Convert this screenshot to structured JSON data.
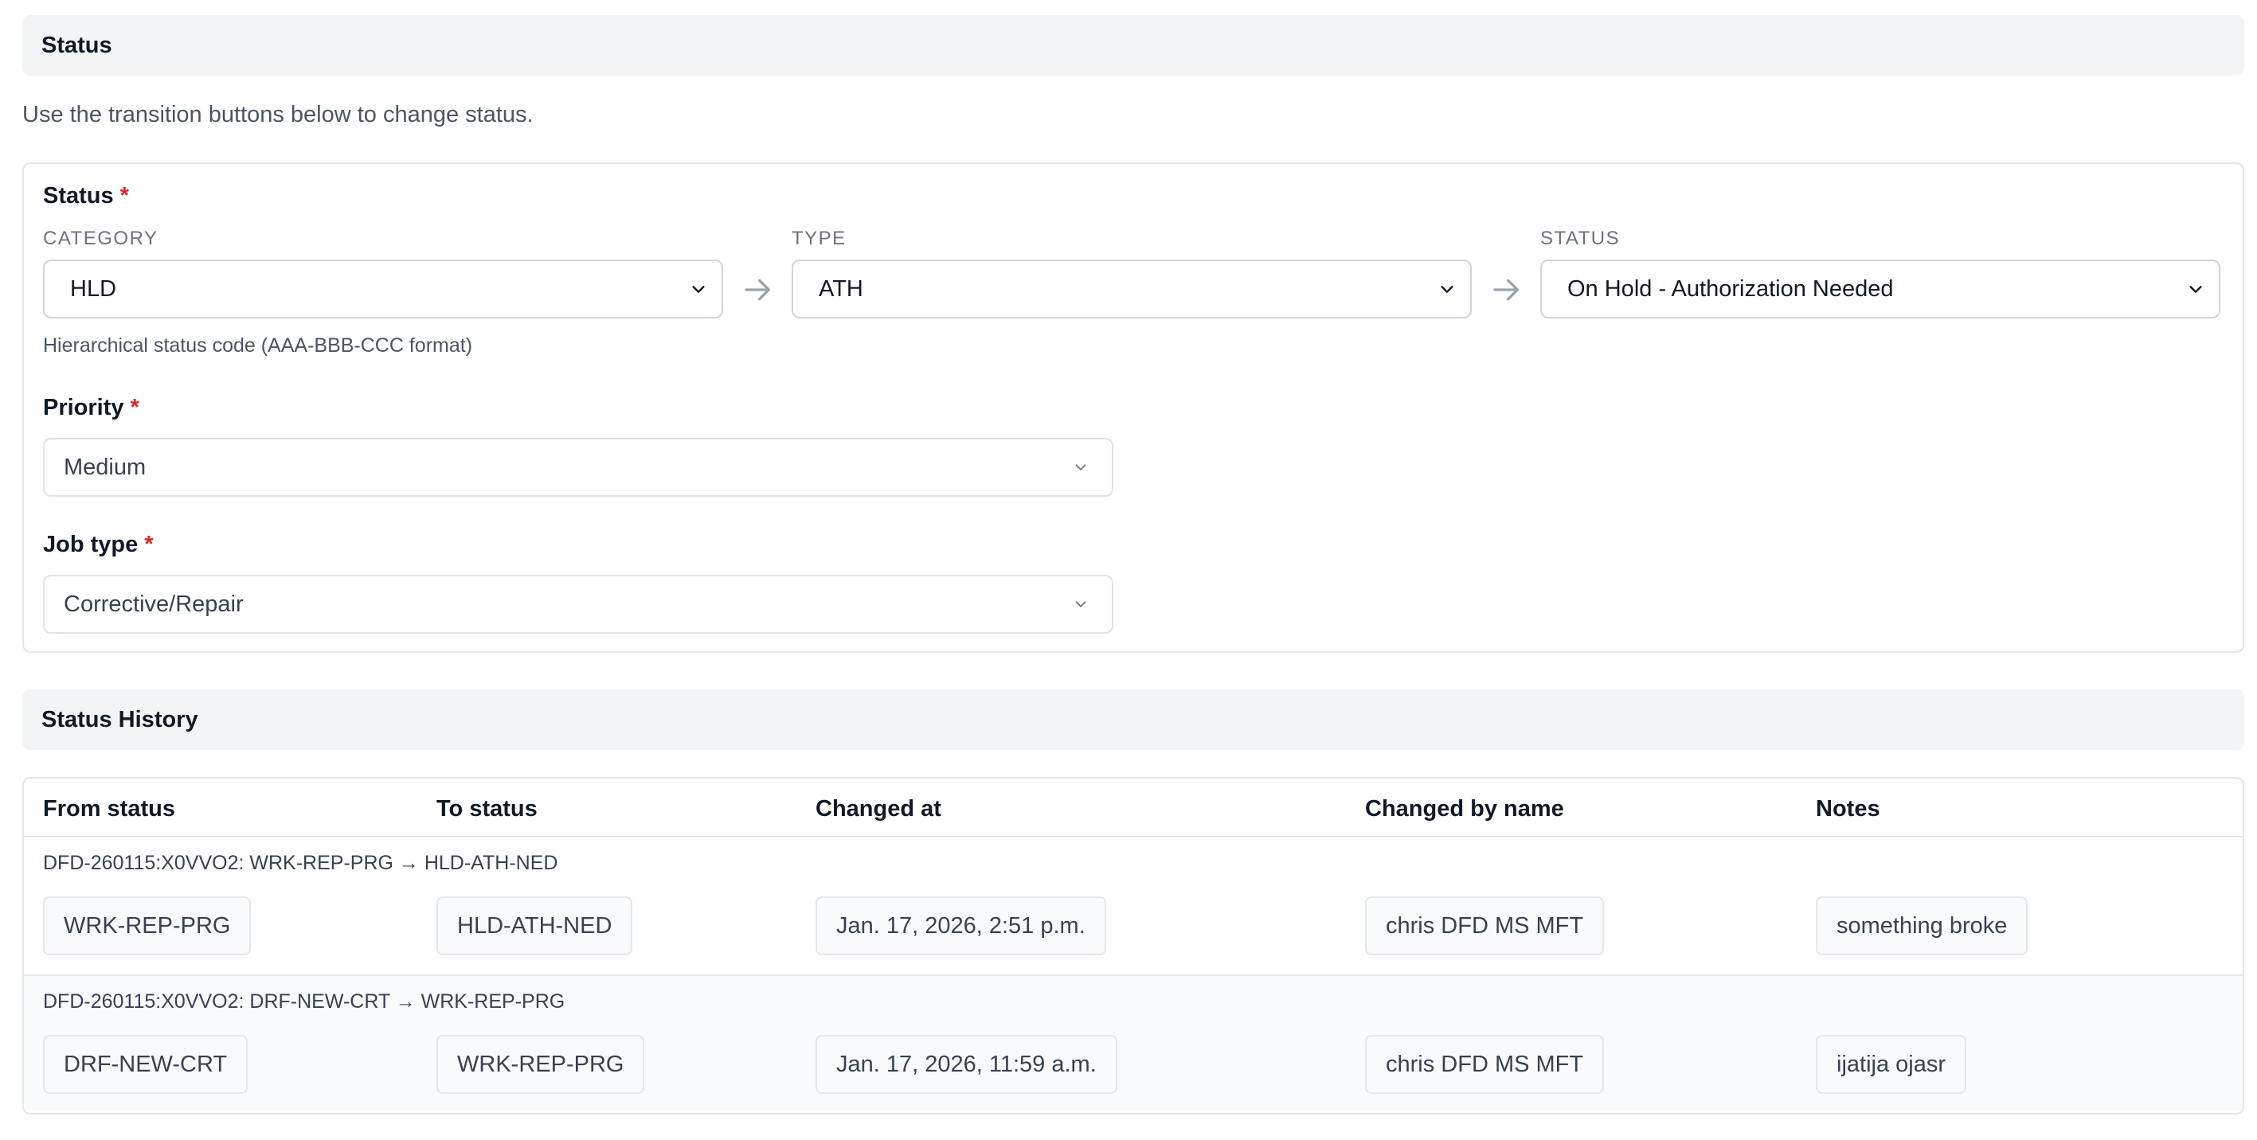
{
  "status_section": {
    "title": "Status",
    "help": "Use the transition buttons below to change status."
  },
  "status_field": {
    "label": "Status",
    "required_mark": "*",
    "category_label": "CATEGORY",
    "category_value": "HLD",
    "type_label": "TYPE",
    "type_value": "ATH",
    "status_label": "STATUS",
    "status_value": "On Hold - Authorization Needed",
    "hint": "Hierarchical status code (AAA-BBB-CCC format)"
  },
  "priority_field": {
    "label": "Priority",
    "required_mark": "*",
    "value": "Medium"
  },
  "job_type_field": {
    "label": "Job type",
    "required_mark": "*",
    "value": "Corrective/Repair"
  },
  "history": {
    "title": "Status History",
    "columns": [
      "From status",
      "To status",
      "Changed at",
      "Changed by name",
      "Notes"
    ],
    "rows": [
      {
        "title": "DFD-260115:X0VVO2: WRK-REP-PRG → HLD-ATH-NED",
        "from": "WRK-REP-PRG",
        "to": "HLD-ATH-NED",
        "changed_at": "Jan. 17, 2026, 2:51 p.m.",
        "changed_by": "chris DFD MS MFT",
        "notes": "something broke"
      },
      {
        "title": "DFD-260115:X0VVO2: DRF-NEW-CRT → WRK-REP-PRG",
        "from": "DRF-NEW-CRT",
        "to": "WRK-REP-PRG",
        "changed_at": "Jan. 17, 2026, 11:59 a.m.",
        "changed_by": "chris DFD MS MFT",
        "notes": "ijatija ojasr"
      }
    ]
  }
}
